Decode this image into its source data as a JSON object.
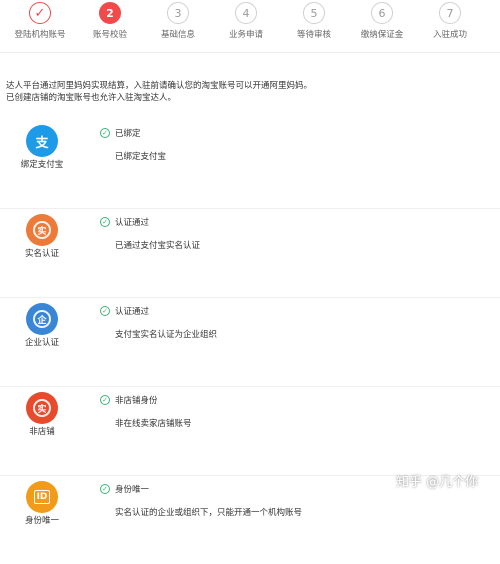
{
  "steps": [
    {
      "label": "登陆机构账号",
      "state": "done",
      "mark": "✓"
    },
    {
      "label": "账号校验",
      "state": "active",
      "mark": "2"
    },
    {
      "label": "基础信息",
      "state": "pending",
      "mark": "3"
    },
    {
      "label": "业务申请",
      "state": "pending",
      "mark": "4"
    },
    {
      "label": "等待审核",
      "state": "pending",
      "mark": "5"
    },
    {
      "label": "缴纳保证金",
      "state": "pending",
      "mark": "6"
    },
    {
      "label": "入驻成功",
      "state": "pending",
      "mark": "7"
    }
  ],
  "intro": {
    "line1": "达人平台通过阿里妈妈实现结算，入驻前请确认您的淘宝账号可以开通阿里妈妈。",
    "line2": "已创建店铺的淘宝账号也允许入驻淘宝达人。"
  },
  "checks": [
    {
      "name": "绑定支付宝",
      "status": "已绑定",
      "desc": "已绑定支付宝",
      "icon": "alipay-icon",
      "glyph": "支",
      "color": "#1e9be8"
    },
    {
      "name": "实名认证",
      "status": "认证通过",
      "desc": "已通过支付宝实名认证",
      "icon": "realname-icon",
      "glyph": "实",
      "color": "#ee7a3a"
    },
    {
      "name": "企业认证",
      "status": "认证通过",
      "desc": "支付宝实名认证为企业组织",
      "icon": "enterprise-icon",
      "glyph": "企",
      "color": "#3a86d6"
    },
    {
      "name": "非店铺",
      "status": "非店铺身份",
      "desc": "非在线卖家店铺账号",
      "icon": "nonshop-icon",
      "glyph": "实",
      "color": "#e84a2c"
    },
    {
      "name": "身份唯一",
      "status": "身份唯一",
      "desc": "实名认证的企业或组织下，只能开通一个机构账号",
      "icon": "unique-id-icon",
      "glyph": "ID",
      "color": "#f29b1a"
    }
  ],
  "watermark": "知乎 @几个你",
  "colors": {
    "accent": "#f04a4a",
    "ok": "#3fb37a"
  }
}
